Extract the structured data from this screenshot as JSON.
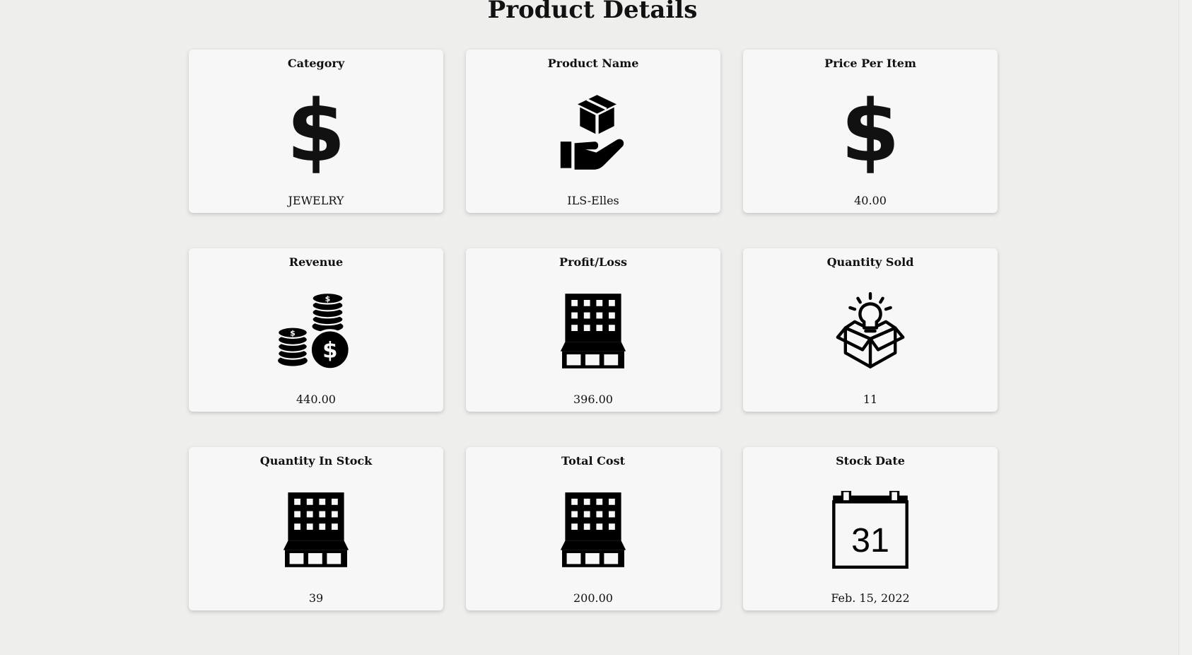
{
  "page": {
    "title": "Product Details"
  },
  "cards": [
    {
      "label": "Category",
      "value": "JEWELRY",
      "icon": "dollar-icon"
    },
    {
      "label": "Product Name",
      "value": "ILS-Elles",
      "icon": "box-in-hand-icon"
    },
    {
      "label": "Price Per Item",
      "value": "40.00",
      "icon": "dollar-icon"
    },
    {
      "label": "Revenue",
      "value": "440.00",
      "icon": "coins-icon"
    },
    {
      "label": "Profit/Loss",
      "value": "396.00",
      "icon": "building-icon"
    },
    {
      "label": "Quantity Sold",
      "value": "11",
      "icon": "idea-box-icon"
    },
    {
      "label": "Quantity In Stock",
      "value": "39",
      "icon": "building-icon"
    },
    {
      "label": "Total Cost",
      "value": "200.00",
      "icon": "building-icon"
    },
    {
      "label": "Stock Date",
      "value": "Feb. 15, 2022",
      "icon": "calendar-icon",
      "icon_text": "31"
    }
  ]
}
